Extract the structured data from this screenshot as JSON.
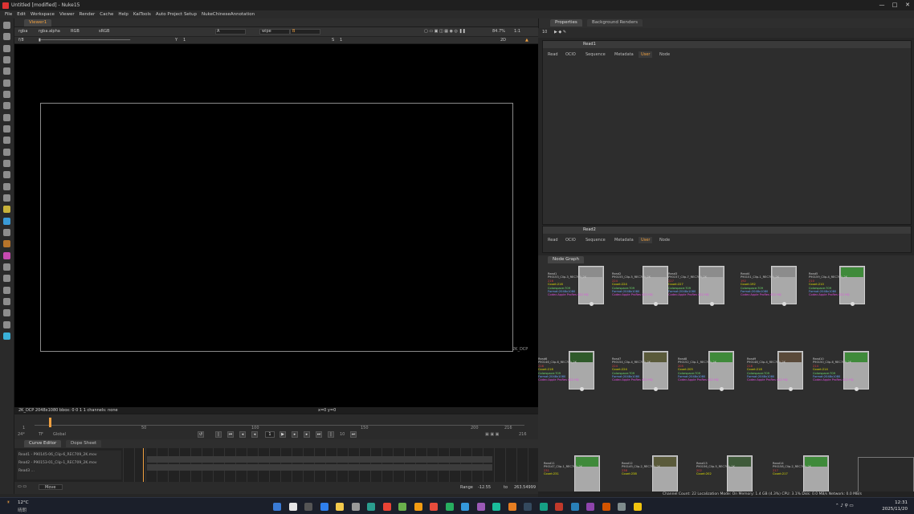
{
  "window": {
    "title": "Untitled [modified] - Nuke15",
    "controls": [
      "—",
      "□",
      "✕"
    ]
  },
  "menu": [
    "File",
    "Edit",
    "Workspace",
    "Viewer",
    "Render",
    "Cache",
    "Help",
    "KaiTools",
    "Auto Project Setup",
    "NukeChineseAnnotation"
  ],
  "viewer": {
    "tab": "Viewer1",
    "channels": "rgba",
    "layer": "rgba.alpha",
    "display": "RGB",
    "colorspace": "sRGB",
    "wipe": "A",
    "blend": "wipe",
    "b_input": "B",
    "zoom": "84.7%",
    "ratio": "1:1",
    "fstop": "f/8",
    "frame_field": "1",
    "gain_label": "Y",
    "gain_value": "1",
    "gamma_label": "S",
    "gamma_value": "1",
    "mode2d": "2D",
    "format_label": "2K_DCP",
    "info": "2K_DCP 2048x1080  bbox: 0 0 1 1 channels: none",
    "coords": "x=0 y=0"
  },
  "timeline": {
    "ticks": [
      "1",
      "50",
      "100",
      "150",
      "200",
      "216"
    ],
    "fps": "24*",
    "tf": "TF",
    "global": "Global",
    "frame": "1",
    "step": "10",
    "end_frame": "216"
  },
  "curve_editor": {
    "tabs": [
      "Curve Editor",
      "Dope Sheet"
    ],
    "rows": [
      "Read1 - P90145-06_Clip-6_REC709_2K.mov",
      "Read2 - P90153-01_Clip-1_REC709_2K.mov",
      "Read3 ..."
    ],
    "mode": "Move",
    "range_label": "Range",
    "range_from": "-12.55",
    "range_to_label": "to",
    "range_to": "263.54999"
  },
  "properties": {
    "tabs": [
      "Properties",
      "Background Renders"
    ],
    "count": "10",
    "panels": [
      {
        "name": "Read1",
        "tabs": [
          "Read",
          "OCIO",
          "Sequence",
          "Metadata",
          "User",
          "Node"
        ],
        "selected": "User"
      },
      {
        "name": "Read2",
        "tabs": [
          "Read",
          "OCIO",
          "Sequence",
          "Metadata",
          "User",
          "Node"
        ],
        "selected": "User"
      }
    ]
  },
  "node_graph": {
    "tab": "Node Graph",
    "nodes": [
      {
        "name": "Read1",
        "file": "P90153_Clip-3_REC709_2K",
        "frames": "216",
        "count": "Count:216",
        "cs": "Colorspace:709",
        "fmt": "Format:2048x1080",
        "codec": "Codec:Apple ProRes 422 HQ"
      },
      {
        "name": "Read2",
        "file": "P90155_Clip-5_REC709_2K",
        "frames": "224",
        "count": "Count:224",
        "cs": "Colorspace:709",
        "fmt": "Format:2048x1080",
        "codec": "Codec:Apple ProRes 422 HQ"
      },
      {
        "name": "Read3",
        "file": "P90157_Clip-7_REC709_2K",
        "frames": "227",
        "count": "Count:227",
        "cs": "Colorspace:709",
        "fmt": "Format:2048x1080",
        "codec": "Codec:Apple ProRes 422 HQ"
      },
      {
        "name": "Read4",
        "file": "P90151_Clip-1_REC709_2K",
        "frames": "192",
        "count": "Count:192",
        "cs": "Colorspace:709",
        "fmt": "Format:2048x1080",
        "codec": "Codec:Apple ProRes 422 HQ"
      },
      {
        "name": "Read5",
        "file": "P90159_Clip-4_REC709_2K",
        "frames": "210",
        "count": "Count:210",
        "cs": "Colorspace:709",
        "fmt": "Format:2048x1080",
        "codec": "Codec:Apple ProRes 422 HQ"
      },
      {
        "name": "Read6",
        "file": "P90146_Clip-6_REC709_2K",
        "frames": "216",
        "count": "Count:216",
        "cs": "Colorspace:709",
        "fmt": "Format:2048x1080",
        "codec": "Codec:Apple ProRes 422 HQ"
      },
      {
        "name": "Read7",
        "file": "P90154_Clip-4_REC709_2K",
        "frames": "224",
        "count": "Count:224",
        "cs": "Colorspace:709",
        "fmt": "Format:2048x1080",
        "codec": "Codec:Apple ProRes 422 HQ"
      },
      {
        "name": "Read8",
        "file": "P90152_Clip-1_REC709_2K",
        "frames": "205",
        "count": "Count:205",
        "cs": "Colorspace:709",
        "fmt": "Format:2048x1080",
        "codec": "Codec:Apple ProRes 422 HQ"
      },
      {
        "name": "Read9",
        "file": "P90148_Clip-4_REC709_2K",
        "frames": "218",
        "count": "Count:218",
        "cs": "Colorspace:709",
        "fmt": "Format:2048x1080",
        "codec": "Codec:Apple ProRes 422 HQ"
      },
      {
        "name": "Read10",
        "file": "P90150_Clip-6_REC709_2K",
        "frames": "214",
        "count": "Count:214",
        "cs": "Colorspace:709",
        "fmt": "Format:2048x1080",
        "codec": "Codec:Apple ProRes 422 HQ"
      },
      {
        "name": "Read11",
        "file": "P90147_Clip-1_REC709_2K",
        "frames": "231",
        "count": "Count:231",
        "cs": "",
        "fmt": "",
        "codec": ""
      },
      {
        "name": "Read12",
        "file": "P90149_Clip-2_REC709_2K",
        "frames": "238",
        "count": "Count:238",
        "cs": "",
        "fmt": "",
        "codec": ""
      },
      {
        "name": "Read13",
        "file": "P90156_Clip-5_REC709_2K",
        "frames": "202",
        "count": "Count:202",
        "cs": "",
        "fmt": "",
        "codec": ""
      },
      {
        "name": "Read14",
        "file": "P90158_Clip-2_REC709_2K",
        "frames": "217",
        "count": "Count:217",
        "cs": "",
        "fmt": "",
        "codec": ""
      }
    ]
  },
  "status": "Channel Count: 22  Localization Mode: On  Memory: 1.4 GB (4.3%)  CPU: 3.1%  Disk: 0.0 MB/s  Network: 0.0 MB/s",
  "taskbar": {
    "weather_temp": "12°C",
    "weather_desc": "晴朗",
    "time": "12:31",
    "date": "2025/11/20",
    "icon_colors": [
      "#3a7bd5",
      "#e6e6e6",
      "#555",
      "#2f80ed",
      "#f2c94c",
      "#999",
      "#2a9d8f",
      "#ea4335",
      "#6ab04c",
      "#f39c12",
      "#e74c3c",
      "#27ae60",
      "#3498db",
      "#9b59b6",
      "#1abc9c",
      "#e67e22",
      "#34495e",
      "#16a085",
      "#c0392b",
      "#2980b9",
      "#8e44ad",
      "#d35400",
      "#7f8c8d",
      "#f1c40f"
    ]
  },
  "colors": {
    "accent": "#f0a040",
    "node_body": "#a9a9a9",
    "label_red": "#e04040",
    "label_yellow": "#e0e000",
    "label_green": "#6fe06f",
    "label_blue": "#6aa8ff",
    "label_magenta": "#e050e0"
  }
}
